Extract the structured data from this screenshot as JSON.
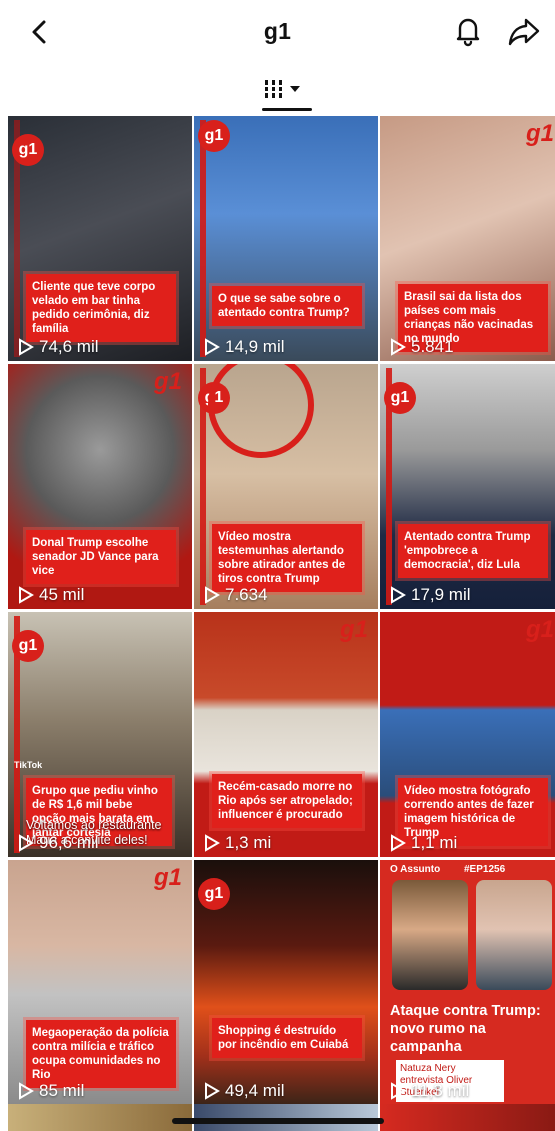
{
  "header": {
    "title": "g1",
    "back_icon": "chevron-left-icon",
    "bell_icon": "bell-icon",
    "share_icon": "share-icon"
  },
  "view_selector": {
    "icon": "grid-view-icon",
    "dropdown_icon": "caret-down-icon"
  },
  "tiles": [
    {
      "caption": "Cliente que teve corpo velado em bar tinha pedido cerimônia, diz família",
      "views": "74,6 mil"
    },
    {
      "caption": "O que se sabe sobre o atentado contra Trump?",
      "views": "14,9 mil"
    },
    {
      "caption": "Brasil sai da lista dos países com mais crianças não vacinadas no mundo",
      "views": "5.841"
    },
    {
      "caption": "Donal Trump escolhe senador JD Vance para vice",
      "views": "45 mil"
    },
    {
      "caption": "Vídeo mostra testemunhas alertando sobre atirador antes de tiros contra Trump",
      "views": "7.634"
    },
    {
      "caption": "Atentado contra Trump 'empobrece a democracia', diz Lula",
      "views": "17,9 mil"
    },
    {
      "caption": "Grupo que pediu vinho de R$ 1,6 mil bebe opção mais barata em jantar cortesia",
      "overlay": "Voltamos ao restaurante Maria a convite deles!",
      "views": "96,6 mil"
    },
    {
      "caption": "Recém-casado morre no Rio após ser atropelado; influencer é procurado",
      "views": "1,3 mi"
    },
    {
      "caption": "Vídeo mostra fotógrafo correndo antes de fazer imagem histórica de Trump",
      "views": "1,1 mi"
    },
    {
      "caption": "Megaoperação da polícia contra milícia e tráfico ocupa comunidades no Rio",
      "views": "85 mil"
    },
    {
      "caption": "Shopping é destruído por incêndio em Cuiabá",
      "views": "49,4 mil"
    },
    {
      "caption": "Ataque contra Trump: novo rumo na campanha",
      "podcast": "O Assunto",
      "episode": "#EP1256",
      "guest": "Natuza Nery entrevista Oliver Stuenkel",
      "views": "11,3 mil"
    }
  ],
  "logo": "g1",
  "tiktok": "TikTok"
}
